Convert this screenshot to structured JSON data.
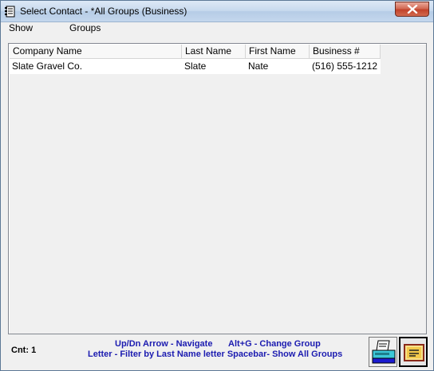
{
  "window": {
    "title": "Select Contact - *All Groups (Business)"
  },
  "menu": {
    "items": [
      "Show",
      "Groups"
    ]
  },
  "table": {
    "columns": [
      "Company Name",
      "Last Name",
      "First Name",
      "Business #"
    ],
    "rows": [
      [
        "Slate Gravel Co.",
        "Slate",
        "Nate",
        "(516) 555-1212"
      ]
    ]
  },
  "footer": {
    "count_label": "Cnt:",
    "count_value": "1",
    "hint_line1_left": "Up/Dn Arrow - Navigate",
    "hint_line1_right": "Alt+G - Change Group",
    "hint_line2": "Letter - Filter by Last Name letter  Spacebar- Show All Groups"
  },
  "icons": {
    "app": "phone-book-icon",
    "close": "close-icon",
    "print": "printer-icon",
    "card": "address-card-icon"
  },
  "colors": {
    "hint_text": "#1b1bb0",
    "close_button": "#c2422a"
  }
}
